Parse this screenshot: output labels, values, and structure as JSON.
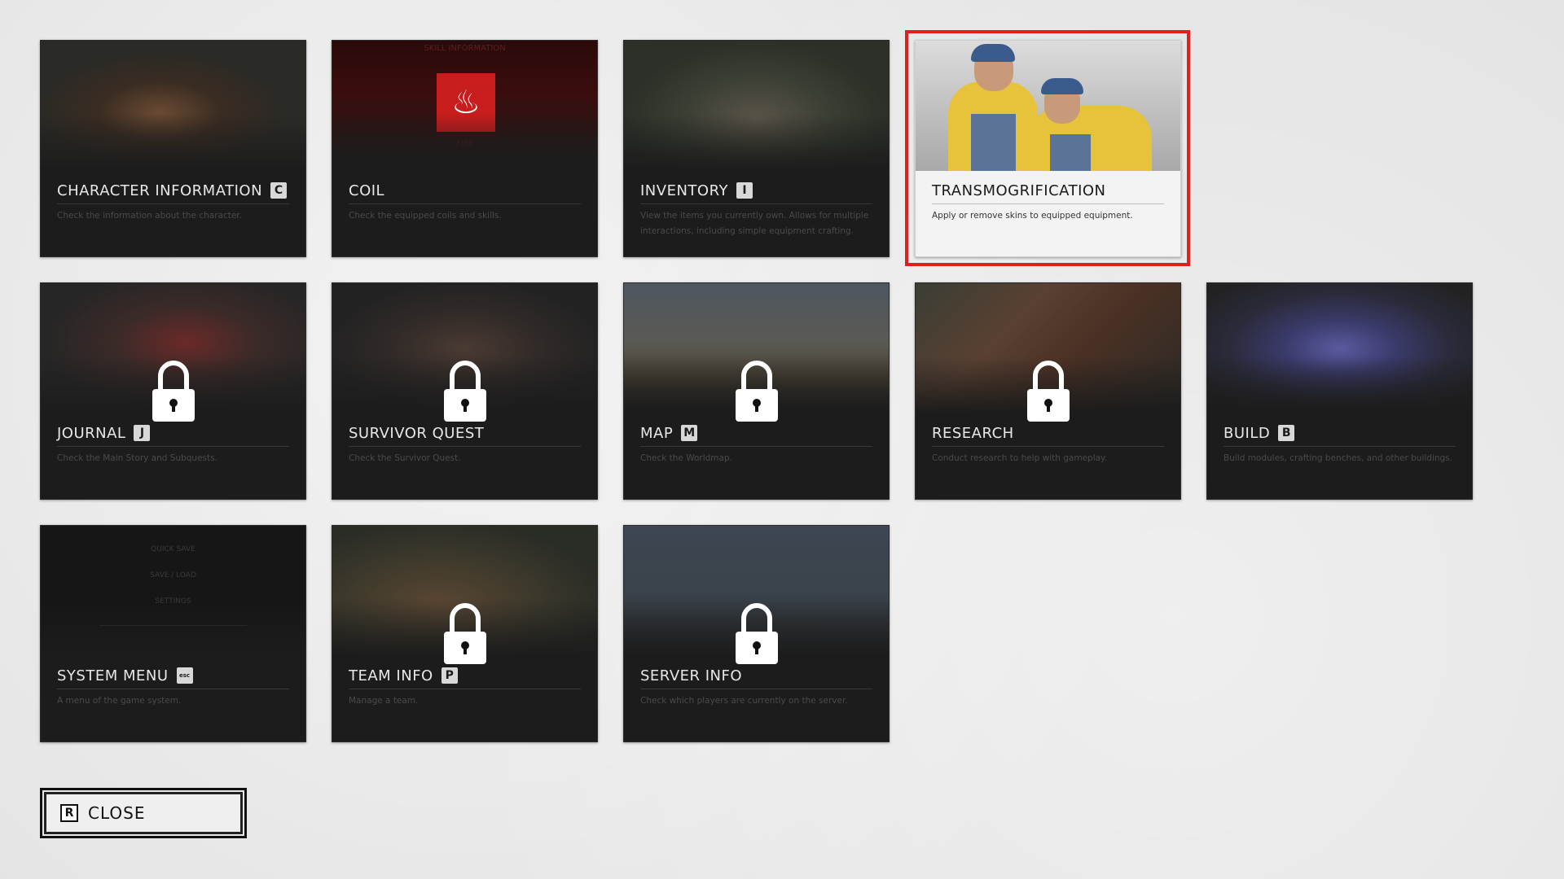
{
  "menu": {
    "cards": [
      {
        "id": "character-information",
        "title": "CHARACTER INFORMATION",
        "key": "C",
        "desc": "Check the information about the character.",
        "locked": false,
        "selected": false
      },
      {
        "id": "coil",
        "title": "COIL",
        "key": "",
        "desc": "Check the equipped coils and skills.",
        "locked": false,
        "selected": false,
        "art_text": {
          "header": "SKILL INFORMATION",
          "caption": "FIRE"
        }
      },
      {
        "id": "inventory",
        "title": "INVENTORY",
        "key": "I",
        "desc": "View the items you currently own. Allows for multiple interactions, including simple equipment crafting.",
        "locked": false,
        "selected": false
      },
      {
        "id": "transmogrification",
        "title": "TRANSMOGRIFICATION",
        "key": "",
        "desc": "Apply or remove skins to equipped equipment.",
        "locked": false,
        "selected": true
      },
      {
        "id": "journal",
        "title": "JOURNAL",
        "key": "J",
        "desc": "Check the Main Story and Subquests.",
        "locked": true,
        "selected": false
      },
      {
        "id": "survivor-quest",
        "title": "SURVIVOR QUEST",
        "key": "",
        "desc": "Check the Survivor Quest.",
        "locked": true,
        "selected": false
      },
      {
        "id": "map",
        "title": "MAP",
        "key": "M",
        "desc": "Check the Worldmap.",
        "locked": true,
        "selected": false
      },
      {
        "id": "research",
        "title": "RESEARCH",
        "key": "",
        "desc": "Conduct research to help with gameplay.",
        "locked": true,
        "selected": false
      },
      {
        "id": "build",
        "title": "BUILD",
        "key": "B",
        "desc": "Build modules, crafting benches, and other buildings.",
        "locked": true,
        "selected": false
      },
      {
        "id": "system-menu",
        "title": "SYSTEM MENU",
        "key": "esc",
        "desc": "A menu of the game system.",
        "locked": false,
        "selected": false,
        "art_text": {
          "items": [
            "QUICK SAVE",
            "SAVE / LOAD",
            "SETTINGS"
          ]
        }
      },
      {
        "id": "team-info",
        "title": "TEAM INFO",
        "key": "P",
        "desc": "Manage a team.",
        "locked": true,
        "selected": false
      },
      {
        "id": "server-info",
        "title": "SERVER INFO",
        "key": "",
        "desc": "Check which players are currently on the server.",
        "locked": true,
        "selected": false
      }
    ]
  },
  "close_button": {
    "key": "R",
    "label": "CLOSE"
  },
  "colors": {
    "selection": "#e02020",
    "card_bg": "#1c1c1c",
    "page_bg": "#e4e4e4"
  }
}
